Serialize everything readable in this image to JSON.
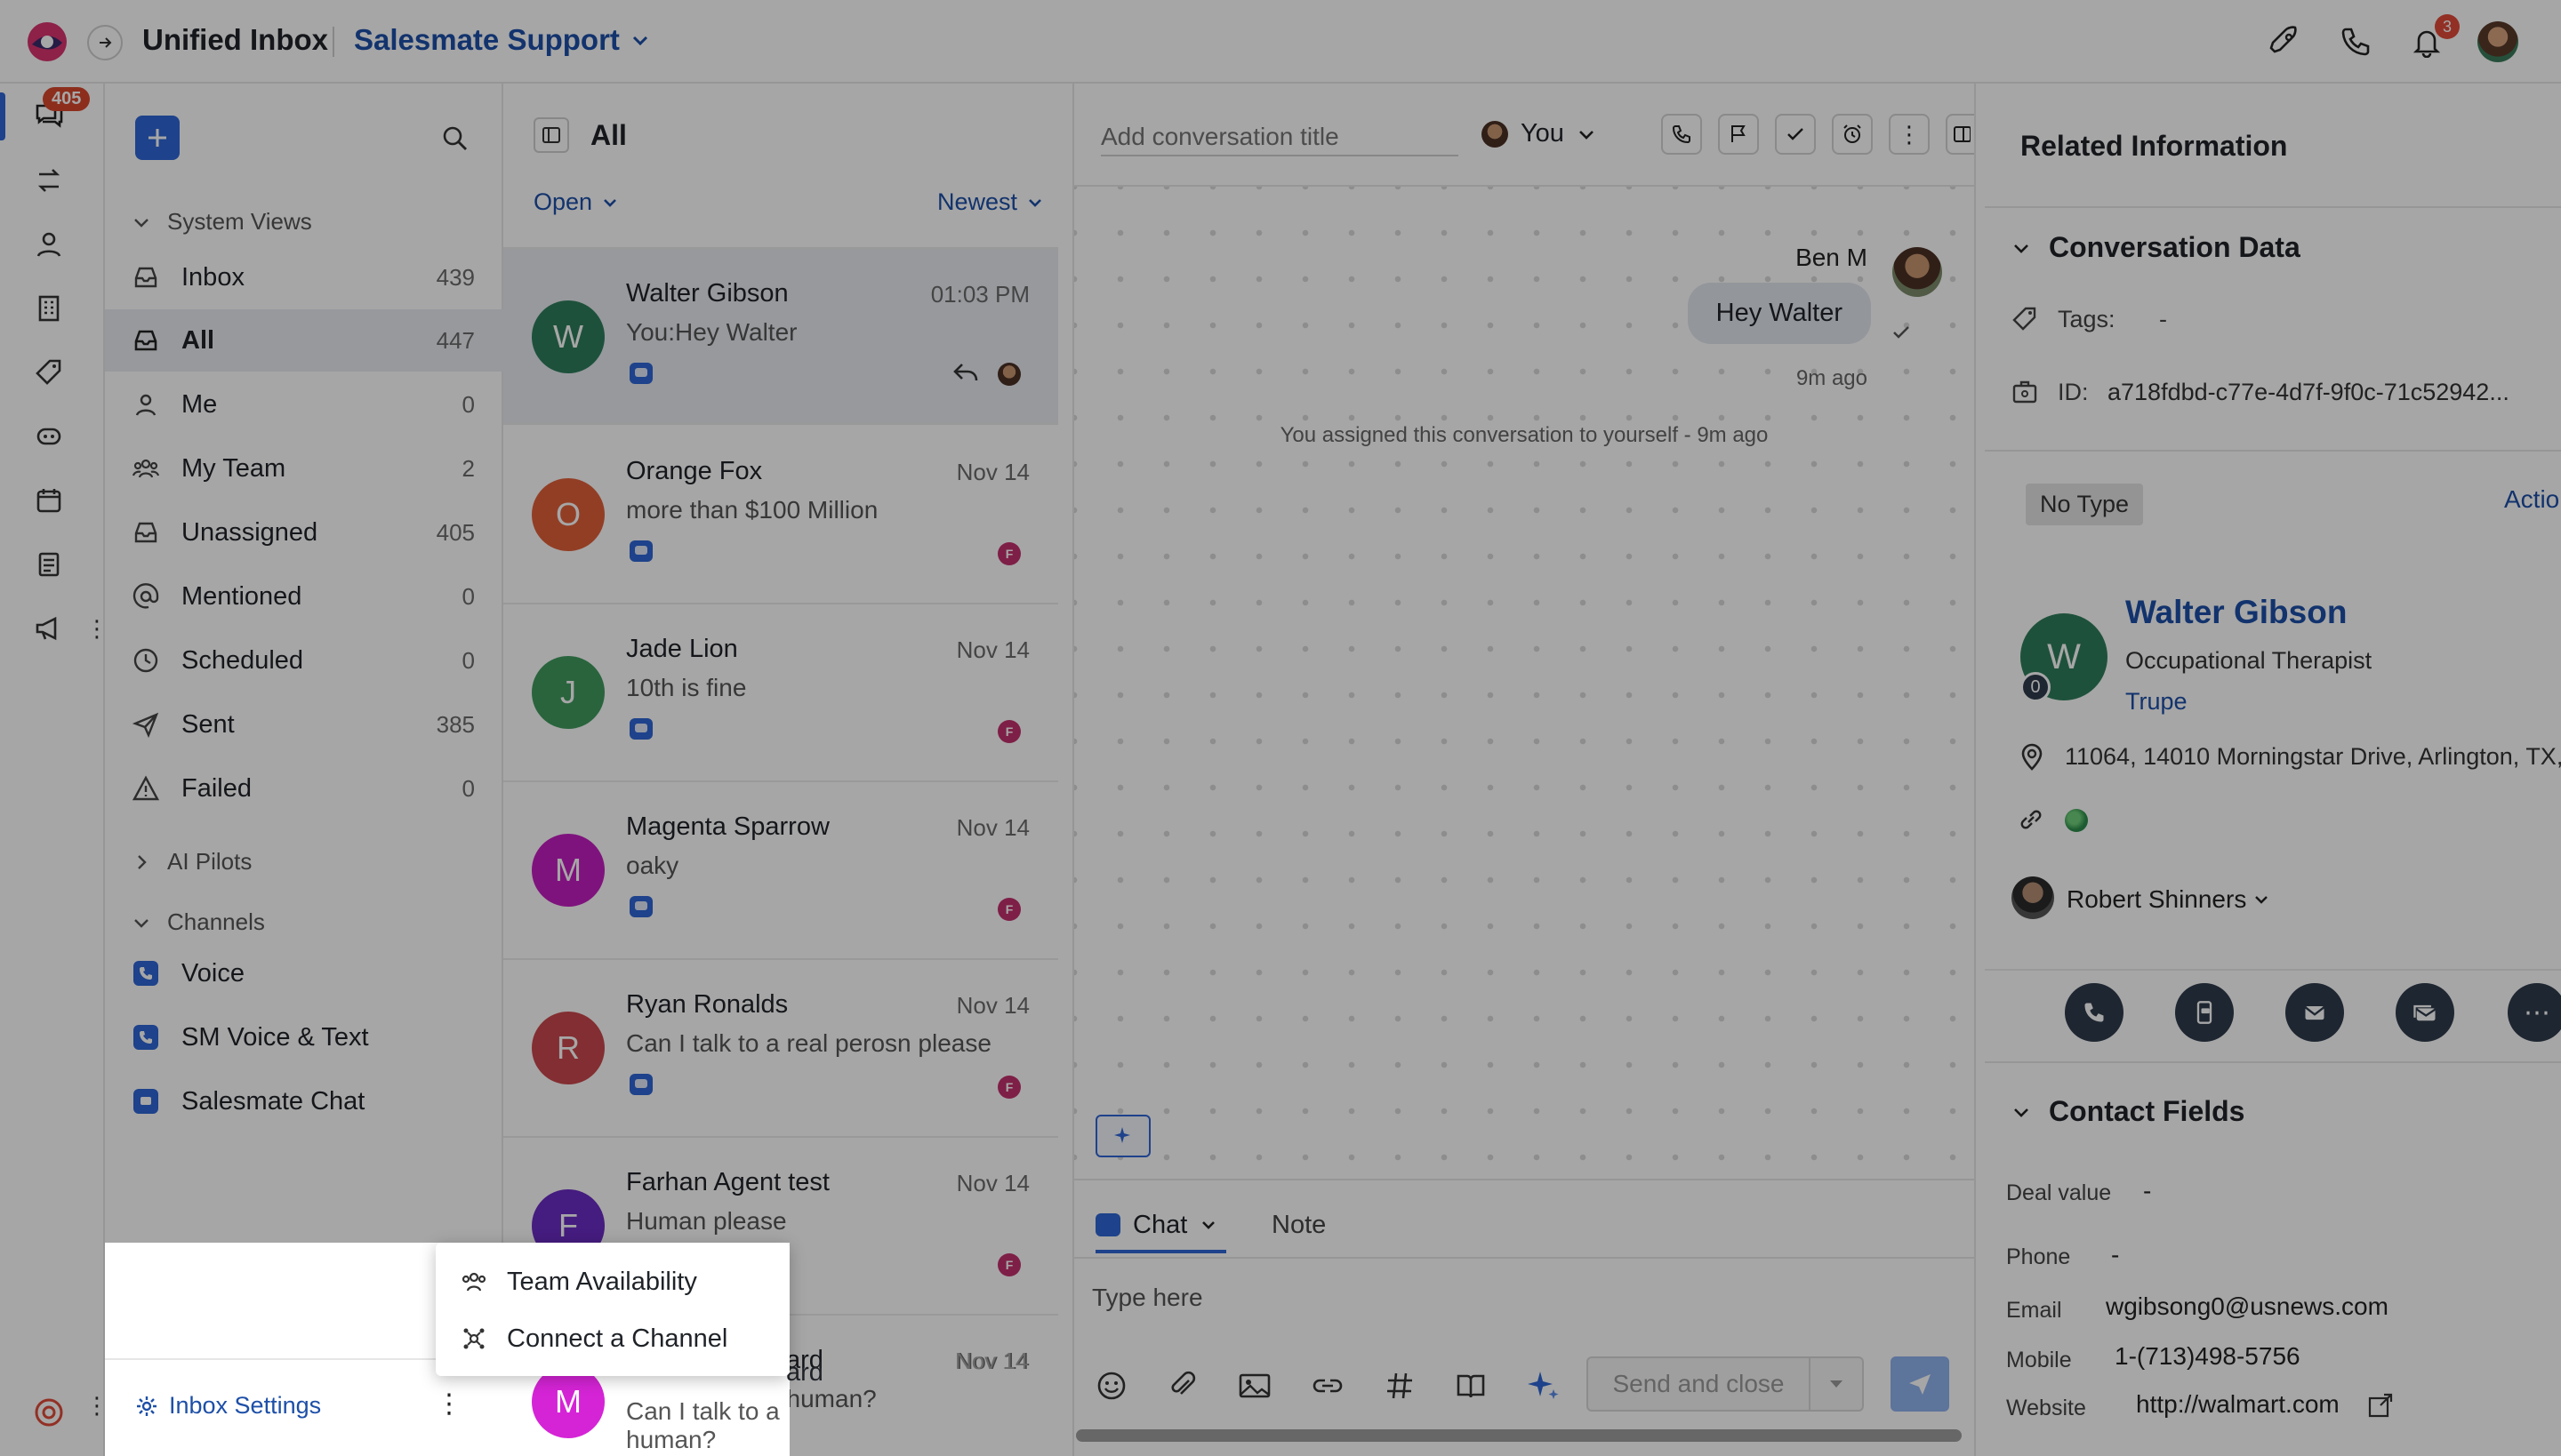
{
  "topbar": {
    "title": "Unified Inbox",
    "workspace": "Salesmate Support",
    "notification_count": "3"
  },
  "rail": {
    "messages_badge": "405"
  },
  "leftnav": {
    "system_views_label": "System Views",
    "items": [
      {
        "label": "Inbox",
        "count": "439"
      },
      {
        "label": "All",
        "count": "447"
      },
      {
        "label": "Me",
        "count": "0"
      },
      {
        "label": "My Team",
        "count": "2"
      },
      {
        "label": "Unassigned",
        "count": "405"
      },
      {
        "label": "Mentioned",
        "count": "0"
      },
      {
        "label": "Scheduled",
        "count": "0"
      },
      {
        "label": "Sent",
        "count": "385"
      },
      {
        "label": "Failed",
        "count": "0"
      }
    ],
    "ai_pilots_label": "AI Pilots",
    "channels_label": "Channels",
    "channels": [
      {
        "label": "Voice"
      },
      {
        "label": "SM Voice & Text"
      },
      {
        "label": "Salesmate Chat"
      }
    ],
    "settings_label": "Inbox Settings"
  },
  "list": {
    "title": "All",
    "status_filter": "Open",
    "sort": "Newest",
    "conversations": [
      {
        "initial": "W",
        "name": "Walter Gibson",
        "time": "01:03 PM",
        "message": "You:Hey Walter",
        "color": "#2e7d5b"
      },
      {
        "initial": "O",
        "name": "Orange Fox",
        "time": "Nov 14",
        "message": "more than $100 Million",
        "color": "#e0603a"
      },
      {
        "initial": "J",
        "name": "Jade Lion",
        "time": "Nov 14",
        "message": "10th is fine",
        "color": "#3f9a5e"
      },
      {
        "initial": "M",
        "name": "Magenta Sparrow",
        "time": "Nov 14",
        "message": "oaky",
        "color": "#c41ec1"
      },
      {
        "initial": "R",
        "name": "Ryan Ronalds",
        "time": "Nov 14",
        "message": "Can I talk to a real perosn please",
        "color": "#c9484d"
      },
      {
        "initial": "F",
        "name": "Farhan Agent test",
        "time": "Nov 14",
        "message": "Human please",
        "color": "#6a2bc3"
      },
      {
        "initial": "M",
        "name": "ard",
        "time": "Nov 14",
        "message": "Can I talk to a human?",
        "color": "#d524d6"
      }
    ],
    "badge_letter": "F"
  },
  "chat": {
    "title_placeholder": "Add conversation title",
    "assignee": "You",
    "sender": "Ben M",
    "bubble": "Hey Walter",
    "bubble_time": "9m ago",
    "system_msg": "You assigned this conversation to yourself - 9m ago",
    "tab_chat": "Chat",
    "tab_note": "Note",
    "composer_placeholder": "Type here",
    "send_label": "Send and close"
  },
  "right": {
    "heading": "Related Information",
    "conv_data_label": "Conversation Data",
    "tags_label": "Tags:",
    "tags_value": "-",
    "id_label": "ID:",
    "id_value": "a718fdbd-c77e-4d7f-9f0c-71c52942...",
    "type_label": "No Type",
    "actions_label": "Actior",
    "contact_initial": "W",
    "contact_badge": "0",
    "contact_name": "Walter Gibson",
    "contact_title": "Occupational Therapist",
    "contact_company": "Trupe",
    "address": "11064, 14010 Morningstar Drive, Arlington, TX,",
    "owner": "Robert Shinners",
    "contact_fields_label": "Contact Fields",
    "fields": [
      {
        "label": "Deal value",
        "value": "-"
      },
      {
        "label": "Phone",
        "value": "-"
      },
      {
        "label": "Email",
        "value": "wgibsong0@usnews.com"
      },
      {
        "label": "Mobile",
        "value": "1-(713)498-5756"
      },
      {
        "label": "Website",
        "value": "http://walmart.com"
      }
    ]
  },
  "menu": {
    "item1": "Team Availability",
    "item2": "Connect a Channel"
  },
  "colors": {
    "accent": "#2f66d6",
    "brand_link": "#1d4fa8",
    "badge_red": "#e04b3a"
  }
}
